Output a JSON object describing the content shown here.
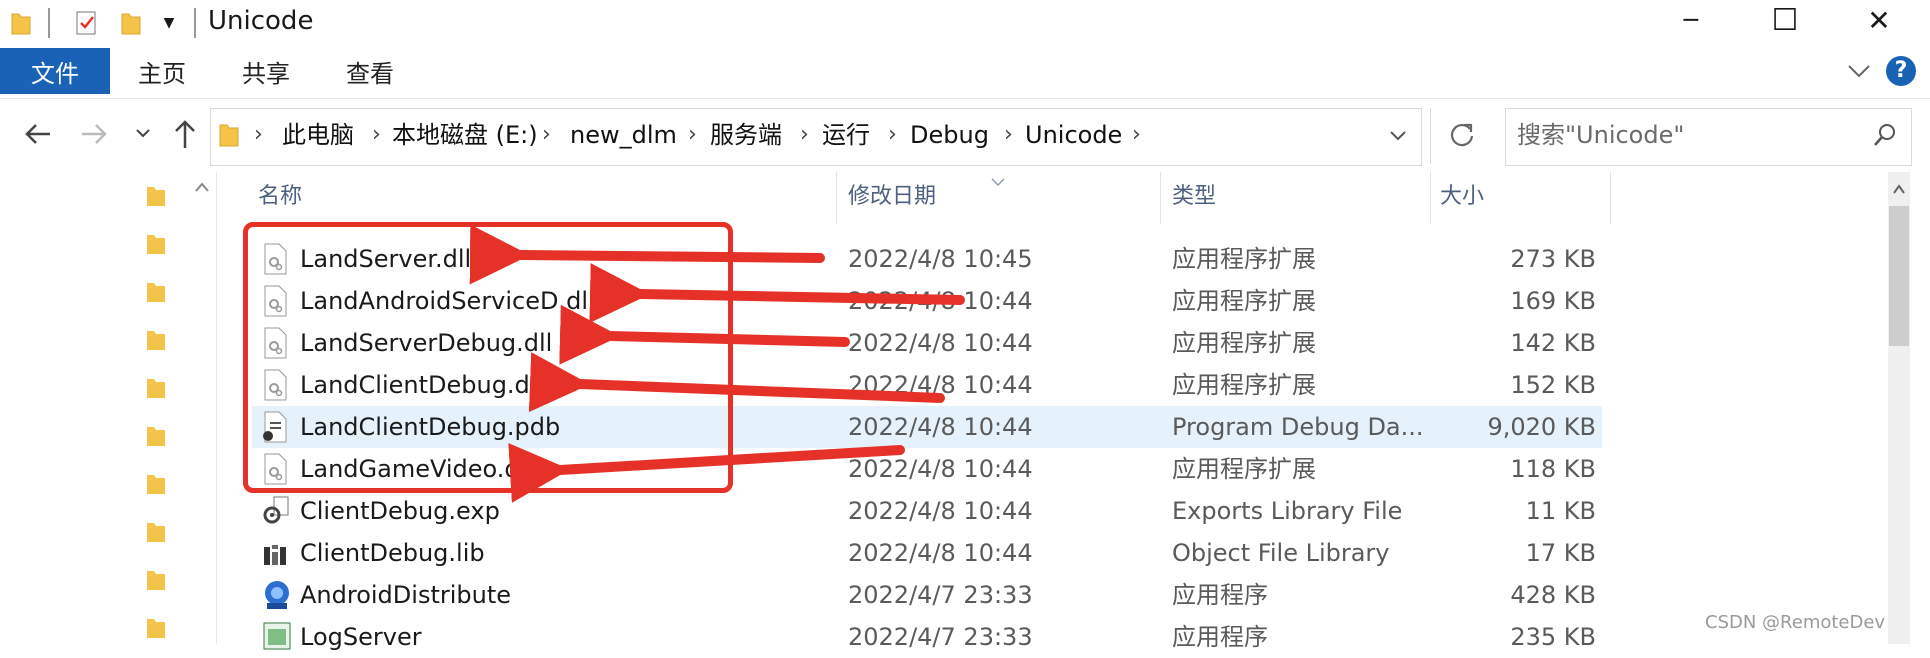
{
  "window": {
    "title": "Unicode",
    "controls": {
      "minimize": "─",
      "maximize": "☐",
      "close": "✕"
    }
  },
  "ribbon": {
    "tabs": [
      "文件",
      "主页",
      "共享",
      "查看"
    ],
    "help_icon": "?"
  },
  "address_bar": {
    "breadcrumbs": [
      "此电脑",
      "本地磁盘 (E:)",
      "new_dlm",
      "服务端",
      "运行",
      "Debug",
      "Unicode"
    ]
  },
  "search": {
    "placeholder": "搜索\"Unicode\""
  },
  "columns": {
    "name": "名称",
    "date": "修改日期",
    "type": "类型",
    "size": "大小"
  },
  "files": [
    {
      "name": "LandServer.dll",
      "date": "2022/4/8 10:45",
      "type": "应用程序扩展",
      "size": "273 KB",
      "icon": "dll-icon"
    },
    {
      "name": "LandAndroidServiceD.dll",
      "date": "2022/4/8 10:44",
      "type": "应用程序扩展",
      "size": "169 KB",
      "icon": "dll-icon"
    },
    {
      "name": "LandServerDebug.dll",
      "date": "2022/4/8 10:44",
      "type": "应用程序扩展",
      "size": "142 KB",
      "icon": "dll-icon"
    },
    {
      "name": "LandClientDebug.dll",
      "date": "2022/4/8 10:44",
      "type": "应用程序扩展",
      "size": "152 KB",
      "icon": "dll-icon"
    },
    {
      "name": "LandClientDebug.pdb",
      "date": "2022/4/8 10:44",
      "type": "Program Debug Da...",
      "size": "9,020 KB",
      "icon": "pdb-icon",
      "selected": true
    },
    {
      "name": "LandGameVideo.dll",
      "date": "2022/4/8 10:44",
      "type": "应用程序扩展",
      "size": "118 KB",
      "icon": "dll-icon"
    },
    {
      "name": "ClientDebug.exp",
      "date": "2022/4/8 10:44",
      "type": "Exports Library File",
      "size": "11 KB",
      "icon": "exp-icon"
    },
    {
      "name": "ClientDebug.lib",
      "date": "2022/4/8 10:44",
      "type": "Object File Library",
      "size": "17 KB",
      "icon": "lib-icon"
    },
    {
      "name": "AndroidDistribute",
      "date": "2022/4/7 23:33",
      "type": "应用程序",
      "size": "428 KB",
      "icon": "exe-icon"
    },
    {
      "name": "LogServer",
      "date": "2022/4/7 23:33",
      "type": "应用程序",
      "size": "235 KB",
      "icon": "exe-icon"
    }
  ],
  "watermark": "CSDN @RemoteDev",
  "colors": {
    "ribbon_file_tab": "#1a62b5",
    "selection": "#e5f2fb",
    "annotation": "#e53127",
    "folder": "#f3c34a"
  }
}
